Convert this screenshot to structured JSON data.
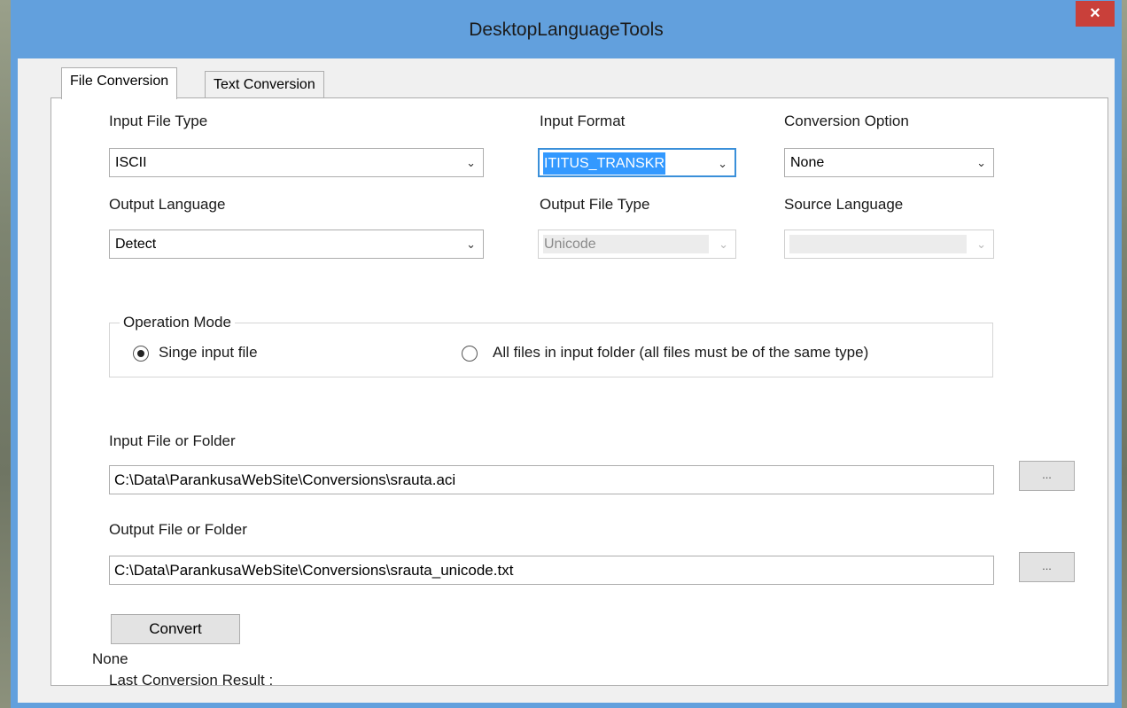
{
  "window": {
    "title": "DesktopLanguageTools",
    "close_glyph": "×"
  },
  "tabs": [
    {
      "label": "File Conversion",
      "selected": true
    },
    {
      "label": "Text Conversion",
      "selected": false
    }
  ],
  "form": {
    "input_file_type": {
      "label": "Input File Type",
      "value": "ISCII"
    },
    "input_format": {
      "label": "Input Format",
      "value": "ITITUS_TRANSKR"
    },
    "conversion_option": {
      "label": "Conversion Option",
      "value": "None"
    },
    "output_language": {
      "label": "Output Language",
      "value": "Detect"
    },
    "output_file_type": {
      "label": "Output File Type",
      "value": "Unicode",
      "enabled": false
    },
    "source_language": {
      "label": "Source Language",
      "value": "",
      "enabled": false
    },
    "operation_mode": {
      "label": "Operation Mode",
      "options": [
        {
          "label": "Singe input file",
          "selected": true
        },
        {
          "label": "All files in input folder (all files must be of the same type)",
          "selected": false
        }
      ]
    },
    "input_path": {
      "label": "Input File or Folder",
      "value": "C:\\Data\\ParankusaWebSite\\Conversions\\srauta.aci"
    },
    "output_path": {
      "label": "Output File or Folder",
      "value": "C:\\Data\\ParankusaWebSite\\Conversions\\srauta_unicode.txt"
    },
    "browse_label": "...",
    "convert_label": "Convert",
    "result_label": "Last Conversion Result :",
    "result_value": "None"
  },
  "icons": {
    "dropdown": "chevron-down-icon",
    "close": "close-icon"
  },
  "colors": {
    "titlebar": "#62a0dd",
    "close": "#c9403a",
    "selection": "#3399ff"
  }
}
